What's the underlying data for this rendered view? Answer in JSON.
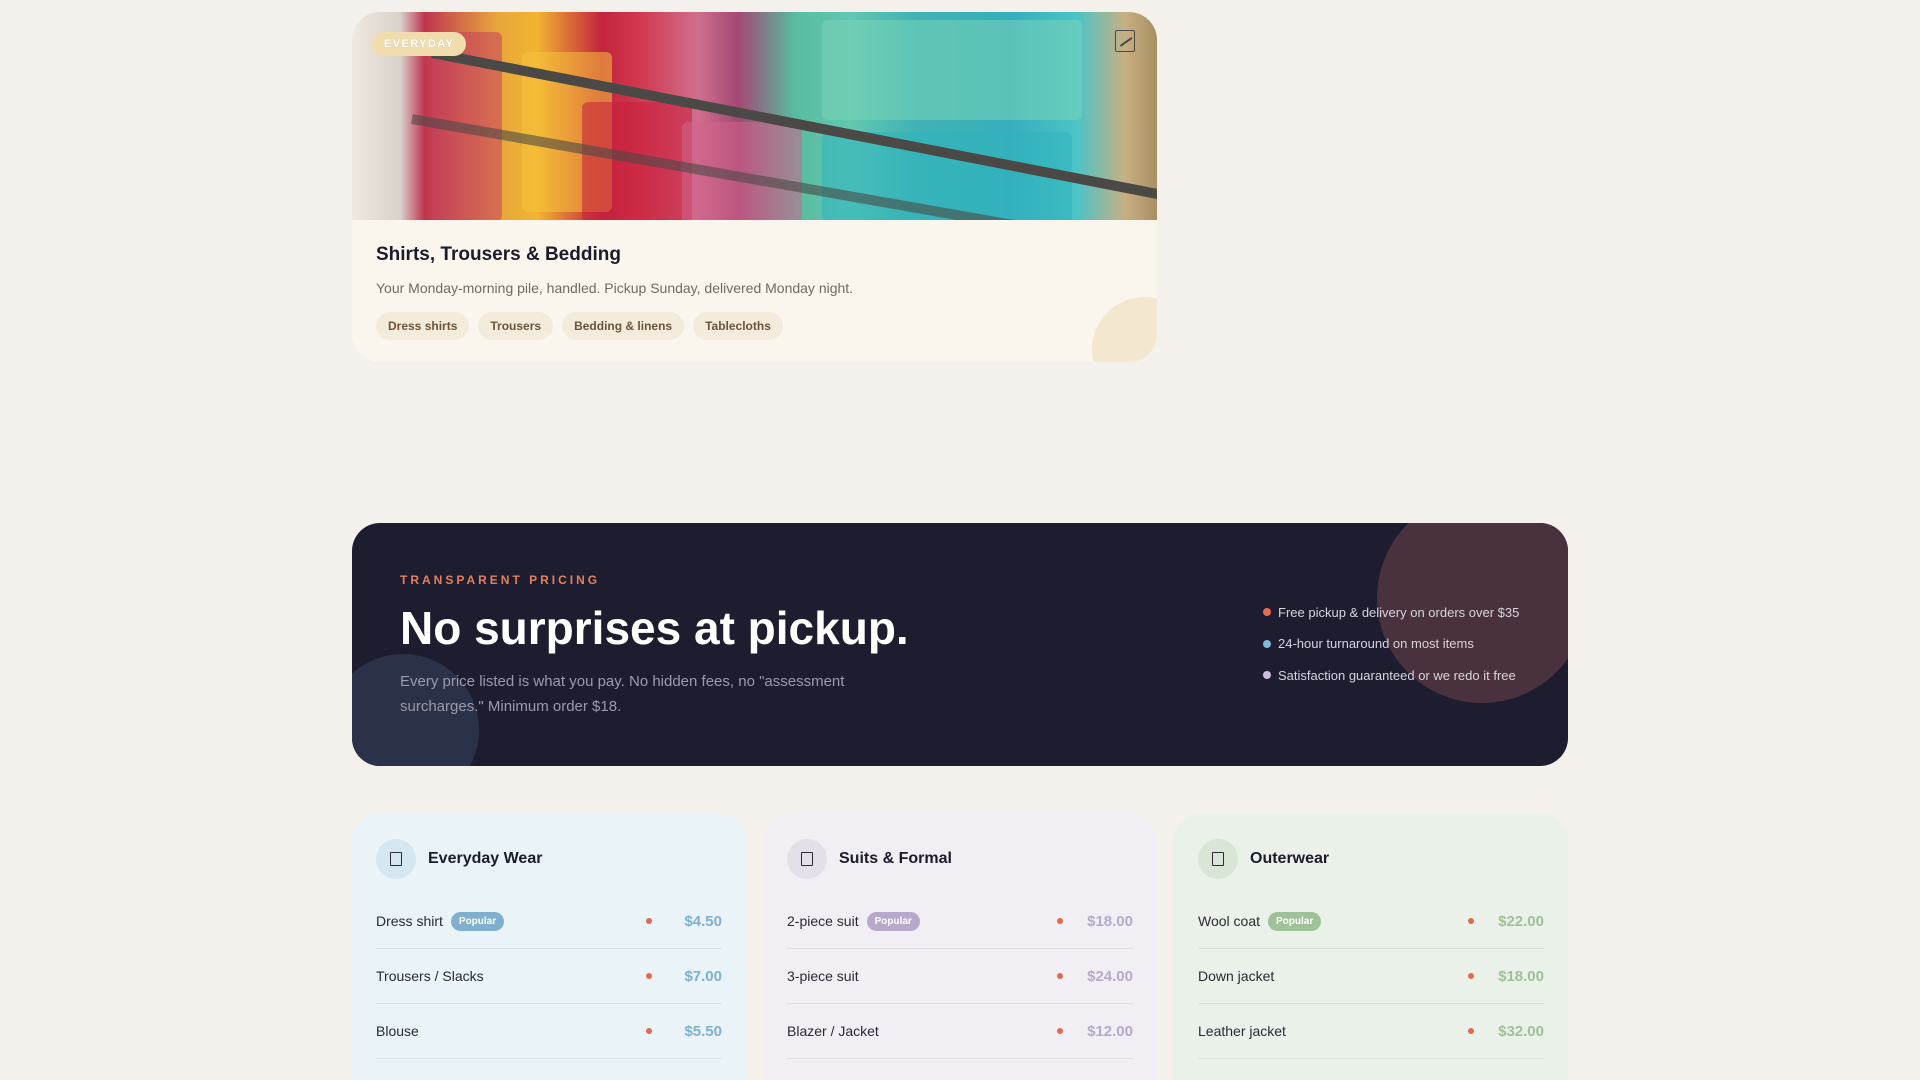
{
  "service_card": {
    "badge": "EVERYDAY",
    "title": "Shirts, Trousers & Bedding",
    "description": "Your Monday-morning pile, handled. Pickup Sunday, delivered Monday night.",
    "tags": [
      "Dress shirts",
      "Trousers",
      "Bedding & linens",
      "Tablecloths"
    ],
    "photo_icon": "broken-image-icon"
  },
  "banner": {
    "eyebrow": "TRANSPARENT PRICING",
    "headline": "No surprises at pickup.",
    "subtext": "Every price listed is what you pay. No hidden fees, no \"assessment surcharges.\" Minimum order $18.",
    "points": [
      {
        "text": "Free pickup & delivery on orders over $35",
        "color": "#e56a4f"
      },
      {
        "text": "24-hour turnaround on most items",
        "color": "#84b8d6"
      },
      {
        "text": "Satisfaction guaranteed or we redo it free",
        "color": "#c8bfdc"
      }
    ]
  },
  "price_cards": [
    {
      "title": "Everyday Wear",
      "icon": "shirt-icon",
      "items": [
        {
          "name": "Dress shirt",
          "badge": "Popular",
          "price": "$4.50"
        },
        {
          "name": "Trousers / Slacks",
          "badge": "",
          "price": "$7.00"
        },
        {
          "name": "Blouse",
          "badge": "",
          "price": "$5.50"
        }
      ]
    },
    {
      "title": "Suits & Formal",
      "icon": "suit-icon",
      "items": [
        {
          "name": "2-piece suit",
          "badge": "Popular",
          "price": "$18.00"
        },
        {
          "name": "3-piece suit",
          "badge": "",
          "price": "$24.00"
        },
        {
          "name": "Blazer / Jacket",
          "badge": "",
          "price": "$12.00"
        }
      ]
    },
    {
      "title": "Outerwear",
      "icon": "coat-icon",
      "items": [
        {
          "name": "Wool coat",
          "badge": "Popular",
          "price": "$22.00"
        },
        {
          "name": "Down jacket",
          "badge": "",
          "price": "$18.00"
        },
        {
          "name": "Leather jacket",
          "badge": "",
          "price": "$32.00"
        }
      ]
    }
  ]
}
